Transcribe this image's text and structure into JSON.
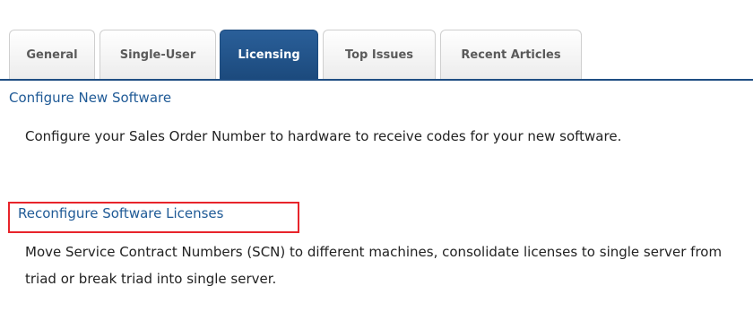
{
  "tabs": [
    {
      "label": "General",
      "active": false
    },
    {
      "label": "Single-User",
      "active": false
    },
    {
      "label": "Licensing",
      "active": true
    },
    {
      "label": "Top Issues",
      "active": false
    },
    {
      "label": "Recent Articles",
      "active": false
    }
  ],
  "content": {
    "items": [
      {
        "link": "Configure New Software",
        "description": "Configure your Sales Order Number to hardware to receive codes for your new software."
      },
      {
        "link": "Reconfigure Software Licenses",
        "description": "Move Service Contract Numbers (SCN) to different machines, consolidate licenses to single server from triad or break triad into single server."
      }
    ]
  },
  "colors": {
    "active_tab": "#1c4a7d",
    "link": "#1f5a96",
    "highlight": "#e8242b"
  }
}
